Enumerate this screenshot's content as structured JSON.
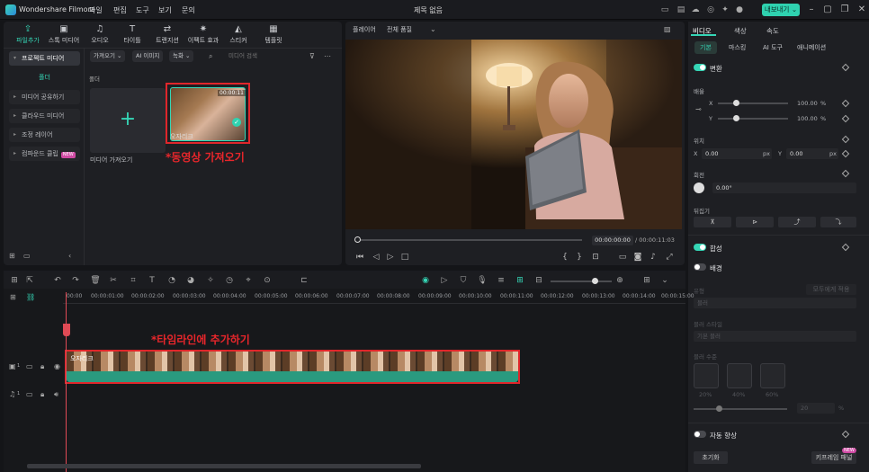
{
  "app": {
    "name": "Wondershare Filmora",
    "project_title": "제목 없음",
    "export_label": "내보내기 ⌄"
  },
  "menu": [
    "파일",
    "편집",
    "도구",
    "보기",
    "문의"
  ],
  "media_toolbar": [
    "파일추가",
    "스톡 미디어",
    "오디오",
    "타이틀",
    "트랜지션",
    "이펙트 효과",
    "스티커",
    "템플릿"
  ],
  "media_nav": {
    "project_media": "프로젝트 미디어",
    "folder": "폴더",
    "items": [
      "미디어 공유하기",
      "클라우드 미디어",
      "조정 레이어",
      "컴파운드 클립"
    ],
    "new_badge": "NEW"
  },
  "media_filters": {
    "import": "가져오기 ⌄",
    "ai_image": "AI 이미지",
    "record": "녹화 ⌄",
    "search_placeholder": "미디어 검색"
  },
  "media_grid": {
    "folder_label": "폴더",
    "import_label": "미디어 가져오기",
    "clip_name": "오자리크",
    "clip_duration": "00:00:11"
  },
  "annotations": {
    "import_video": "*동영상 가져오기",
    "add_timeline": "*타임라인에 추가하기"
  },
  "player": {
    "label": "플레이어",
    "quality": "전체 품질",
    "current_time": "00:00:00:00",
    "total_time": "/ 00:00:11:03"
  },
  "properties": {
    "tabs": [
      "비디오",
      "색상",
      "속도"
    ],
    "subtabs": [
      "기본",
      "마스킹",
      "AI 도구",
      "애니메이션"
    ],
    "transform": "변환",
    "scale": "배율",
    "x": "X",
    "y": "Y",
    "scale_x": "100.00",
    "scale_y": "100.00",
    "percent": "%",
    "position": "위치",
    "pos_x": "0.00",
    "pos_y": "0.00",
    "px": "px",
    "rotate": "회전",
    "rotate_value": "0.00°",
    "flip": "뒤집기",
    "composite": "합성",
    "background": "배경",
    "type": "유형",
    "apply_all": "모두에게 적용",
    "blur": "블러",
    "blur_style": "블러 스타일",
    "basic_blur": "기본 블러",
    "blur_level": "블러 수준",
    "blur_options": [
      "20%",
      "40%",
      "60%"
    ],
    "blur_value": "20",
    "auto_enhance": "자동 향상",
    "reset": "초기화",
    "keyframe_panel": "키프레임 패널",
    "new_badge": "NEW"
  },
  "timeline": {
    "ticks": [
      "00:00",
      "00:00:01:00",
      "00:00:02:00",
      "00:00:03:00",
      "00:00:04:00",
      "00:00:05:00",
      "00:00:06:00",
      "00:00:07:00",
      "00:00:08:00",
      "00:00:09:00",
      "00:00:10:00",
      "00:00:11:00",
      "00:00:12:00",
      "00:00:13:00",
      "00:00:14:00",
      "00:00:15:00"
    ],
    "clip_name": "오자리크",
    "video_track": "1",
    "audio_track": "1"
  }
}
